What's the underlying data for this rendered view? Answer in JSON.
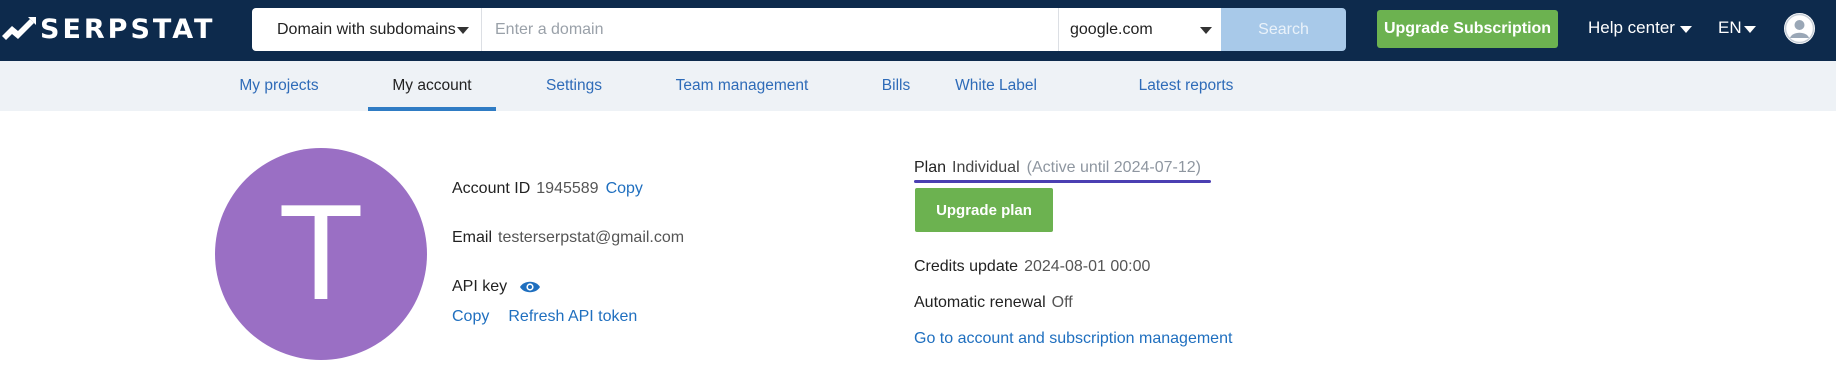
{
  "header": {
    "logo_text": "SERPSTAT",
    "search_type": "Domain with subdomains",
    "domain_placeholder": "Enter a domain",
    "search_engine": "google.com",
    "search_label": "Search",
    "upgrade_subscription": "Upgrade Subscription",
    "help_center": "Help center",
    "language": "EN"
  },
  "tabs": [
    {
      "label": "My projects"
    },
    {
      "label": "My account"
    },
    {
      "label": "Settings"
    },
    {
      "label": "Team management"
    },
    {
      "label": "Bills"
    },
    {
      "label": "White Label"
    },
    {
      "label": "Latest reports"
    }
  ],
  "active_tab": "My account",
  "account": {
    "avatar_letter": "T",
    "account_id_label": "Account ID",
    "account_id": "1945589",
    "copy_label": "Copy",
    "email_label": "Email",
    "email": "testerserpstat@gmail.com",
    "api_key_label": "API key",
    "api_copy_label": "Copy",
    "refresh_token_label": "Refresh API token"
  },
  "plan": {
    "label": "Plan",
    "name": "Individual",
    "status": "(Active until 2024-07-12)",
    "upgrade_label": "Upgrade plan",
    "credits_label": "Credits update",
    "credits_value": "2024-08-01 00:00",
    "renewal_label": "Automatic renewal",
    "renewal_value": "Off",
    "manage_link": "Go to account and subscription management"
  },
  "colors": {
    "header_bg": "#0d2a4c",
    "accent_green": "#6cb250",
    "link_blue": "#1f6fbf",
    "avatar_purple": "#9a6fc4",
    "plan_underline": "#4b3fb2"
  }
}
